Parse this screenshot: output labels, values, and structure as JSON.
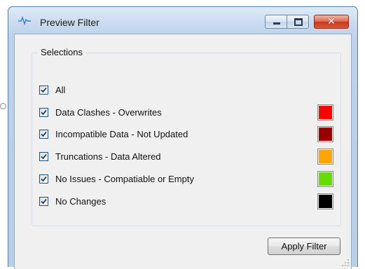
{
  "window": {
    "title": "Preview Filter",
    "icon": "preview-filter-app-icon",
    "controls": [
      "minimize-icon",
      "maximize-icon",
      "close-icon"
    ]
  },
  "group": {
    "title": "Selections",
    "items": [
      {
        "label": "All",
        "checked": true,
        "color": null
      },
      {
        "label": "Data Clashes - Overwrites",
        "checked": true,
        "color": "#ff0000"
      },
      {
        "label": "Incompatible Data - Not Updated",
        "checked": true,
        "color": "#990000"
      },
      {
        "label": "Truncations - Data Altered",
        "checked": true,
        "color": "#ffa500"
      },
      {
        "label": "No Issues - Compatiable or Empty",
        "checked": true,
        "color": "#66dd00"
      },
      {
        "label": "No Changes",
        "checked": true,
        "color": "#000000"
      }
    ]
  },
  "actions": {
    "apply_label": "Apply Filter"
  }
}
